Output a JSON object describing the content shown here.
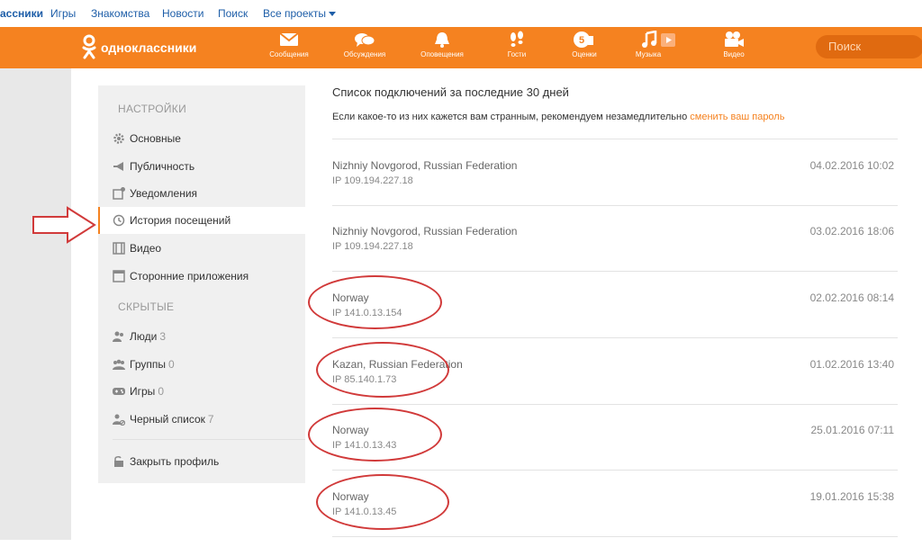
{
  "topnav": {
    "site": "ассники",
    "links": [
      "Игры",
      "Знакомства",
      "Новости",
      "Поиск",
      "Все проекты"
    ]
  },
  "header": {
    "logo_text": "одноклассники",
    "nav": [
      {
        "label": "Сообщения",
        "icon": "envelope-icon"
      },
      {
        "label": "Обсуждения",
        "icon": "chat-bubbles-icon"
      },
      {
        "label": "Оповещения",
        "icon": "bell-icon"
      },
      {
        "label": "Гости",
        "icon": "footprints-icon"
      },
      {
        "label": "Оценки",
        "icon": "rating-icon"
      },
      {
        "label": "Музыка",
        "icon": "music-note-icon"
      },
      {
        "label": "Видео",
        "icon": "video-camera-icon"
      }
    ],
    "search_placeholder": "Поиск",
    "accent": "#f58220"
  },
  "sidebar": {
    "settings_heading": "НАСТРОЙКИ",
    "settings": [
      {
        "label": "Основные",
        "icon": "gear-icon"
      },
      {
        "label": "Публичность",
        "icon": "megaphone-icon"
      },
      {
        "label": "Уведомления",
        "icon": "notification-icon"
      },
      {
        "label": "История посещений",
        "icon": "history-icon"
      },
      {
        "label": "Видео",
        "icon": "film-icon"
      },
      {
        "label": "Сторонние приложения",
        "icon": "apps-icon"
      }
    ],
    "hidden_heading": "СКРЫТЫЕ",
    "hidden": [
      {
        "label": "Люди",
        "count": "3",
        "icon": "people-icon"
      },
      {
        "label": "Группы",
        "count": "0",
        "icon": "groups-icon"
      },
      {
        "label": "Игры",
        "count": "0",
        "icon": "gamepad-icon"
      },
      {
        "label": "Черный список",
        "count": "7",
        "icon": "blocked-user-icon"
      }
    ],
    "close_profile": {
      "label": "Закрыть профиль",
      "icon": "padlock-icon"
    }
  },
  "main": {
    "title": "Список подключений за последние 30 дней",
    "description": "Если какое-то из них кажется вам странным, рекомендуем незамедлительно",
    "link": "сменить ваш пароль",
    "sessions": [
      {
        "location": "Nizhniy Novgorod, Russian Federation",
        "ip": "IP 109.194.227.18",
        "date": "04.02.2016 10:02"
      },
      {
        "location": "Nizhniy Novgorod, Russian Federation",
        "ip": "IP 109.194.227.18",
        "date": "03.02.2016 18:06"
      },
      {
        "location": "Norway",
        "ip": "IP 141.0.13.154",
        "date": "02.02.2016 08:14"
      },
      {
        "location": "Kazan, Russian Federation",
        "ip": "IP 85.140.1.73",
        "date": "01.02.2016 13:40"
      },
      {
        "location": "Norway",
        "ip": "IP 141.0.13.43",
        "date": "25.01.2016 07:11"
      },
      {
        "location": "Norway",
        "ip": "IP 141.0.13.45",
        "date": "19.01.2016 15:38"
      }
    ]
  }
}
